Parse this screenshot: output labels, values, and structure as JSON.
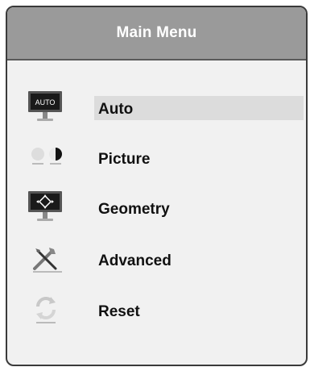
{
  "menu": {
    "title": "Main Menu",
    "items": [
      {
        "label": "Auto",
        "icon": "monitor-auto-icon",
        "screen_text": "AUTO",
        "selected": true
      },
      {
        "label": "Picture",
        "icon": "contrast-circles-icon",
        "selected": false
      },
      {
        "label": "Geometry",
        "icon": "monitor-geometry-icon",
        "selected": false
      },
      {
        "label": "Advanced",
        "icon": "tools-icon",
        "selected": false
      },
      {
        "label": "Reset",
        "icon": "reset-arrows-icon",
        "selected": false
      }
    ]
  },
  "colors": {
    "header_bg": "#9a9a9a",
    "panel_bg": "#f1f1f1",
    "selection_bg": "#dcdcdc",
    "border": "#3a3a3a"
  }
}
